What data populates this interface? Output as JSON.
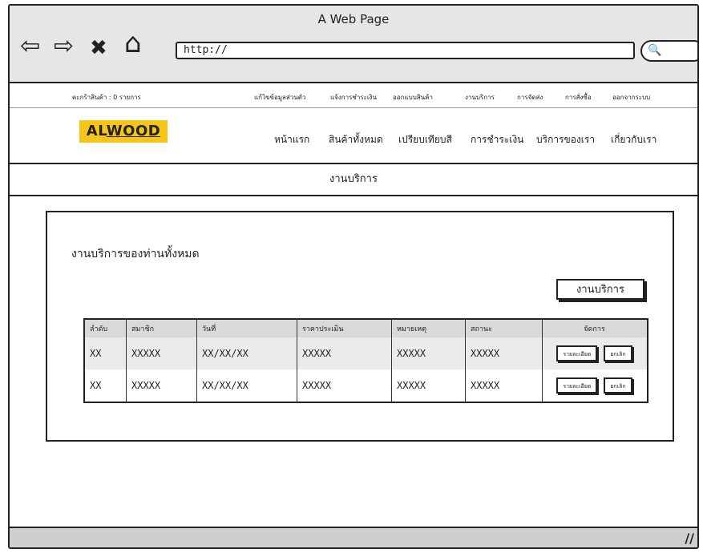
{
  "browser": {
    "title": "A Web Page",
    "url": "http://",
    "back_glyph": "⇦",
    "forward_glyph": "⇨",
    "close_glyph": "✖",
    "home_glyph": "⌂",
    "search_glyph": "🔍"
  },
  "topstrip": {
    "cart": "ตะกร้าสินค้า : 0 รายการ",
    "links": [
      "แก้ไขข้อมูลส่วนตัว",
      "แจ้งการชำระเงิน",
      "ออกแบบสินค้า",
      "งานบริการ",
      "การจัดส่ง",
      "การสั่งซื้อ",
      "ออกจากระบบ"
    ]
  },
  "logo": {
    "brand_pre": "AL",
    "brand_post": "WOOD",
    "color": "#f5c518"
  },
  "nav": [
    "หน้าแรก",
    "สินค้าทั้งหมด",
    "เปรียบเทียบสี",
    "การชำระเงิน",
    "บริการของเรา",
    "เกี่ยวกับเรา"
  ],
  "subheader": "งานบริการ",
  "panel": {
    "title": "งานบริการของท่านทั้งหมด",
    "service_button": "งานบริการ"
  },
  "table": {
    "headers": [
      "ลำดับ",
      "สมาชิก",
      "วันที่",
      "ราคาประเมิน",
      "หมายเหตุ",
      "สถานะ",
      "จัดการ"
    ],
    "rows": [
      [
        "XX",
        "XXXXX",
        "XX/XX/XX",
        "XXXXX",
        "XXXXX",
        "XXXXX"
      ],
      [
        "XX",
        "XXXXX",
        "XX/XX/XX",
        "XXXXX",
        "XXXXX",
        "XXXXX"
      ]
    ],
    "detail_label": "รายละเอียด",
    "cancel_label": "ยกเลิก"
  }
}
